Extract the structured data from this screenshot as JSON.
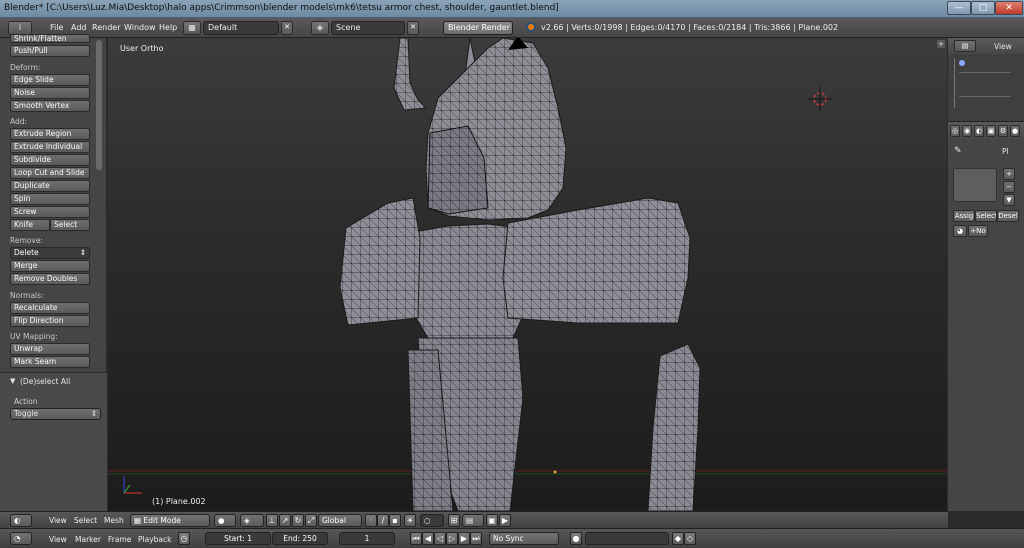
{
  "window": {
    "title": "Blender* [C:\\Users\\Luz.Mia\\Desktop\\halo apps\\Crimmson\\blender models\\mk6\\tetsu  armor chest, shoulder, gauntlet.blend]",
    "min_glyph": "—",
    "max_glyph": "□",
    "close_glyph": "✕"
  },
  "info_header": {
    "editor_icon": "i",
    "menus": [
      "File",
      "Add",
      "Render",
      "Window",
      "Help"
    ],
    "screen_layout": "Default",
    "scene": "Scene",
    "render_engine": "Blender Render",
    "stats": "v2.66 | Verts:0/1998 | Edges:0/4170 | Faces:0/2184 | Tris:3866 | Plane.002"
  },
  "tool_shelf": {
    "top_cut_label": "Shrink/Flatten",
    "push_pull": "Push/Pull",
    "deform_label": "Deform:",
    "deform": [
      "Edge Slide",
      "Noise",
      "Smooth Vertex"
    ],
    "add_label": "Add:",
    "add": [
      "Extrude Region",
      "Extrude Individual",
      "Subdivide",
      "Loop Cut and Slide",
      "Duplicate",
      "Spin",
      "Screw"
    ],
    "knife": "Knife",
    "select": "Select",
    "remove_label": "Remove:",
    "delete": "Delete",
    "merge": "Merge",
    "remove_doubles": "Remove Doubles",
    "normals_label": "Normals:",
    "recalculate": "Recalculate",
    "flip_direction": "Flip Direction",
    "uv_label": "UV Mapping:",
    "unwrap": "Unwrap",
    "mark_seam": "Mark Seam"
  },
  "operator_panel": {
    "title": "(De)select All",
    "action_label": "Action",
    "action_value": "Toggle"
  },
  "viewport": {
    "view_name": "User Ortho",
    "object_label": "(1) Plane.002"
  },
  "outliner": {
    "view_label": "View"
  },
  "properties": {
    "assign": "Assig",
    "select": "Select",
    "deselect": "Desel",
    "new_label": "+No",
    "pin_label": "Pl"
  },
  "view_header": {
    "menus": [
      "View",
      "Select",
      "Mesh"
    ],
    "mode": "Edit Mode",
    "orientation": "Global"
  },
  "timeline": {
    "menus": [
      "View",
      "Marker",
      "Frame",
      "Playback"
    ],
    "start": "Start: 1",
    "end": "End: 250",
    "current": "1",
    "sync": "No Sync"
  },
  "colors": {
    "mesh_face": "#8d8d96",
    "mesh_edge": "#1a1a1a",
    "viewport_top": "#3c3c3c",
    "viewport_bottom": "#1c1c1c",
    "cursor": "#d04040"
  }
}
